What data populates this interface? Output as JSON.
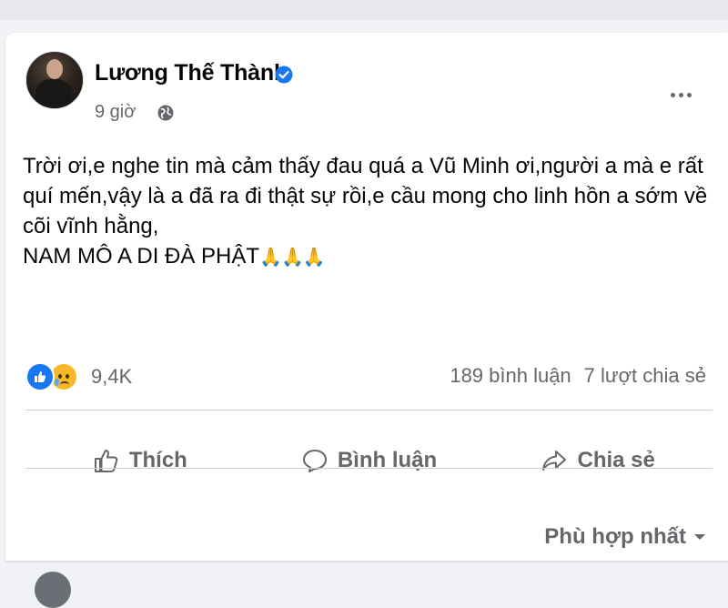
{
  "post": {
    "author": "Lương Thế Thành",
    "time": "9 giờ",
    "lines": [
      "Trời ơi,e nghe tin mà cảm thấy đau quá a Vũ Minh ơi,người a mà e rất",
      "quí mến,vậy là a đã ra đi thật sự rồi,e cầu mong cho linh hồn a sớm về",
      "cõi vĩnh hằng,",
      "NAM MÔ A DI ĐÀ PHẬT"
    ],
    "emoji": "🙏🙏🙏"
  },
  "stats": {
    "reactions": "9,4K",
    "comments": "189 bình luận",
    "shares": "7 lượt chia sẻ"
  },
  "actions": {
    "like": "Thích",
    "comment": "Bình luận",
    "share": "Chia sẻ"
  },
  "sort": {
    "label": "Phù hợp nhất"
  },
  "icons": {
    "verified": "verified-badge-icon",
    "privacy": "globe-icon",
    "more": "more-options-icon",
    "like": "thumbs-up-icon",
    "comment": "comment-bubble-icon",
    "share": "share-arrow-icon",
    "sort": "caret-down-icon"
  },
  "colors": {
    "brand": "#1877f2",
    "secondary_text": "#65676b",
    "sad_reaction": "#f7b928"
  }
}
